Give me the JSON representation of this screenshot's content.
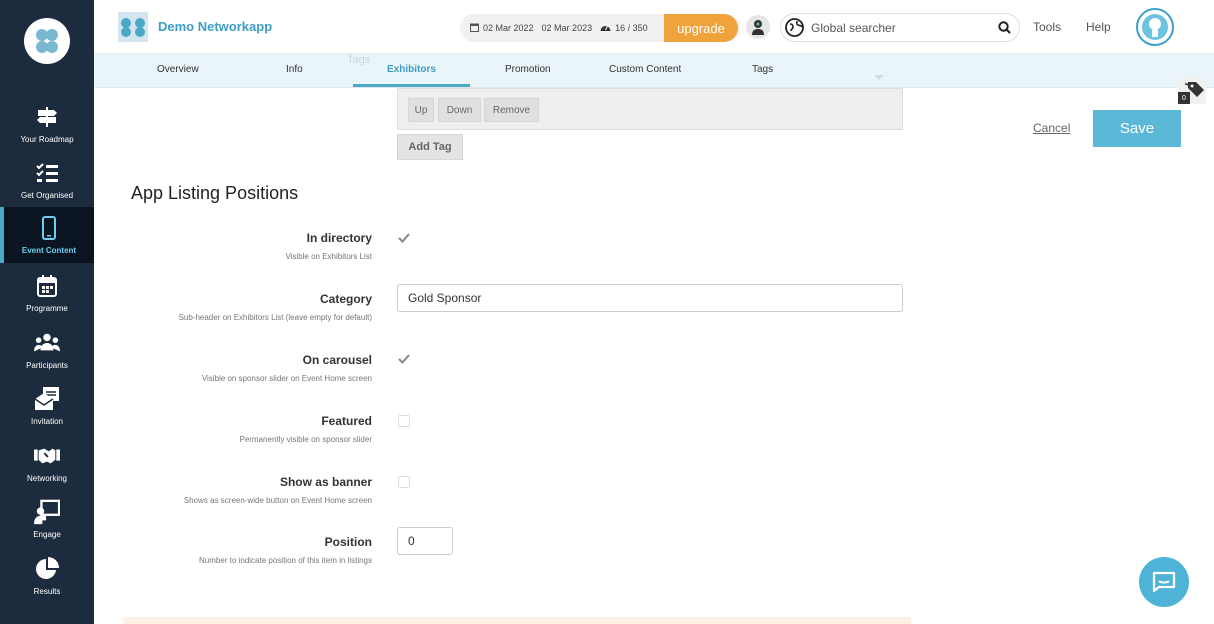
{
  "sidebar": {
    "items": [
      {
        "label": "Your Roadmap",
        "icon": "signpost-icon"
      },
      {
        "label": "Get Organised",
        "icon": "checklist-icon"
      },
      {
        "label": "Event Content",
        "icon": "mobile-icon",
        "active": true
      },
      {
        "label": "Programme",
        "icon": "calendar-icon"
      },
      {
        "label": "Participants",
        "icon": "users-icon"
      },
      {
        "label": "Invitation",
        "icon": "invitation-icon"
      },
      {
        "label": "Networking",
        "icon": "handshake-icon"
      },
      {
        "label": "Engage",
        "icon": "presentation-icon"
      },
      {
        "label": "Results",
        "icon": "pie-chart-icon"
      }
    ]
  },
  "header": {
    "app_name": "Demo Networkapp",
    "date_start": "02 Mar 2022",
    "date_end": "02 Mar 2023",
    "usage": "16 / 350",
    "upgrade_label": "upgrade",
    "search_placeholder": "Global searcher",
    "tools_label": "Tools",
    "help_label": "Help"
  },
  "tabs": [
    {
      "label": "Overview"
    },
    {
      "label": "Info"
    },
    {
      "label": "Exhibitors",
      "active": true
    },
    {
      "label": "Promotion"
    },
    {
      "label": "Custom Content"
    },
    {
      "label": "Tags"
    }
  ],
  "tags_widget": {
    "up_label": "Up",
    "down_label": "Down",
    "remove_label": "Remove",
    "add_tag_label": "Add Tag",
    "badge_count": "0"
  },
  "actions": {
    "cancel_label": "Cancel",
    "save_label": "Save"
  },
  "section": {
    "title": "App Listing Positions"
  },
  "fields": {
    "in_directory": {
      "label": "In directory",
      "help": "Visible on Exhibitors List",
      "checked": true
    },
    "category": {
      "label": "Category",
      "help": "Sub-header on Exhibitors List (leave empty for default)",
      "value": "Gold Sponsor"
    },
    "on_carousel": {
      "label": "On carousel",
      "help": "Visible on sponsor slider on Event Home screen",
      "checked": true
    },
    "featured": {
      "label": "Featured",
      "help": "Permanently visible on sponsor slider",
      "checked": false
    },
    "show_as_banner": {
      "label": "Show as banner",
      "help": "Shows as screen-wide button on Event Home screen",
      "checked": false
    },
    "position": {
      "label": "Position",
      "help": "Number to indicate position of this item in listings",
      "value": "0"
    }
  },
  "colors": {
    "sidebar": "#1d2b3e",
    "accent": "#4ba8c6",
    "upgrade": "#f0a33a",
    "save": "#5bb8d6"
  }
}
